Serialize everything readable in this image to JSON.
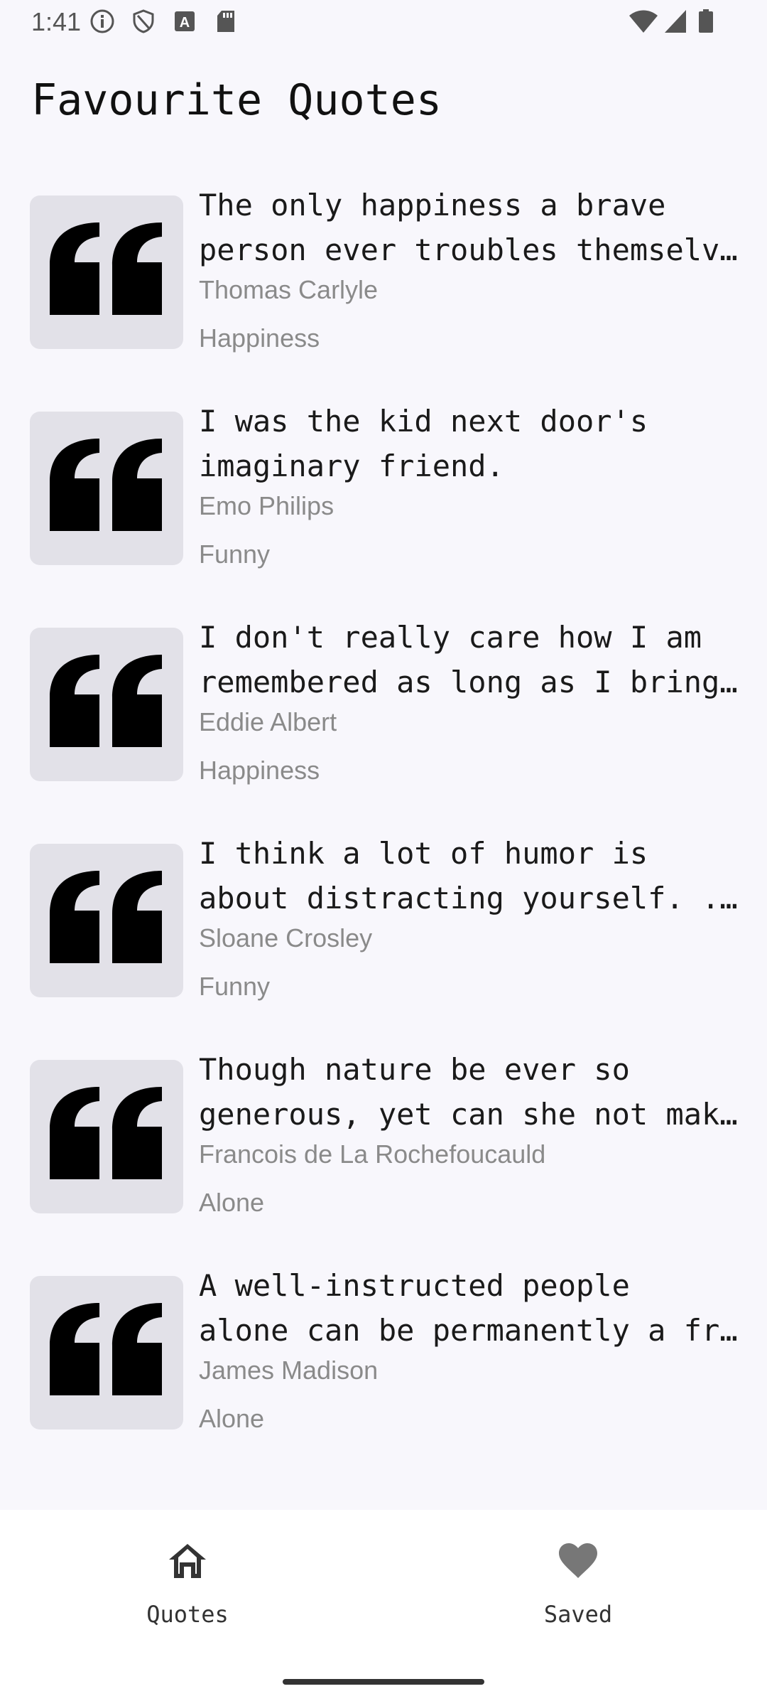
{
  "status_bar": {
    "time": "1:41",
    "left_icons": [
      "info-icon",
      "shield-icon",
      "font-a-icon",
      "sd-card-icon"
    ],
    "right_icons": [
      "wifi-icon",
      "signal-icon",
      "battery-icon"
    ]
  },
  "header": {
    "title": "Favourite Quotes"
  },
  "quotes": [
    {
      "lines": [
        "The only happiness a brave",
        "person ever troubles themselves..."
      ],
      "author": "Thomas Carlyle",
      "category": "Happiness"
    },
    {
      "lines": [
        "I was the kid next door's",
        "imaginary friend."
      ],
      "author": "Emo Philips",
      "category": "Funny"
    },
    {
      "lines": [
        "I don't really care how I am",
        "remembered as long as I bring..."
      ],
      "author": "Eddie Albert",
      "category": "Happiness"
    },
    {
      "lines": [
        "I think a lot of humor is",
        "about distracting yourself. ..."
      ],
      "author": "Sloane Crosley",
      "category": "Funny"
    },
    {
      "lines": [
        "Though nature be ever so",
        "generous, yet can she not make..."
      ],
      "author": "Francois de La Rochefoucauld",
      "category": "Alone"
    },
    {
      "lines": [
        "A well-instructed people",
        "alone can be permanently a free..."
      ],
      "author": "James Madison",
      "category": "Alone"
    }
  ],
  "bottom_nav": {
    "items": [
      {
        "label": "Quotes",
        "icon": "home-icon"
      },
      {
        "label": "Saved",
        "icon": "heart-icon"
      }
    ]
  },
  "colors": {
    "background": "#f8f7fc",
    "thumb": "#e2e1e8",
    "secondary_text": "#8a8a8a",
    "nav_background": "#ffffff"
  }
}
